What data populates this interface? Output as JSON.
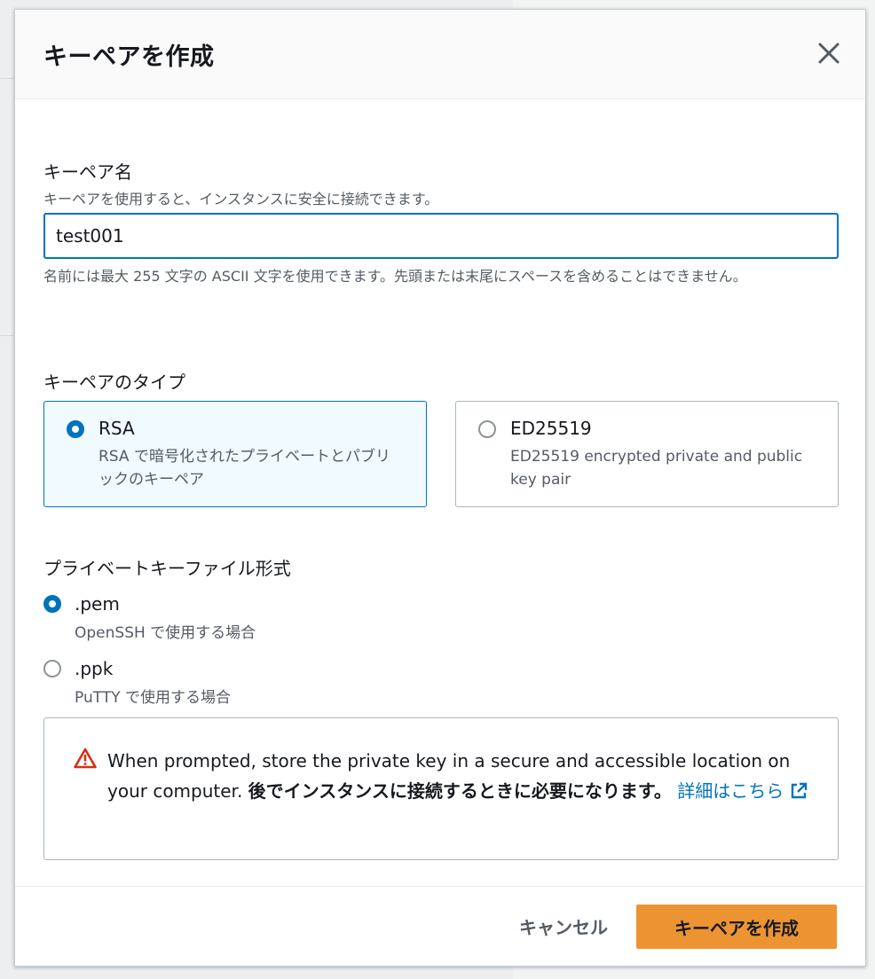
{
  "modal": {
    "title": "キーペアを作成",
    "close_label": "閉じる"
  },
  "key_name": {
    "label": "キーペア名",
    "description": "キーペアを使用すると、インスタンスに安全に接続できます。",
    "value": "test001",
    "constraint": "名前には最大 255 文字の ASCII 文字を使用できます。先頭または末尾にスペースを含めることはできません。"
  },
  "key_type": {
    "label": "キーペアのタイプ",
    "options": [
      {
        "title": "RSA",
        "description": "RSA で暗号化されたプライベートとパブリックのキーペア",
        "selected": true
      },
      {
        "title": "ED25519",
        "description": "ED25519 encrypted private and public key pair",
        "selected": false
      }
    ]
  },
  "file_format": {
    "label": "プライベートキーファイル形式",
    "options": [
      {
        "title": ".pem",
        "description": "OpenSSH で使用する場合",
        "selected": true
      },
      {
        "title": ".ppk",
        "description": "PuTTY で使用する場合",
        "selected": false
      }
    ]
  },
  "alert": {
    "text_en": "When prompted, store the private key in a secure and accessible location on your computer.",
    "text_bold": "後でインスタンスに接続するときに必要になります。",
    "link": "詳細はこちら",
    "icon": "warning-icon",
    "link_icon": "external-link-icon"
  },
  "footer": {
    "cancel_label": "キャンセル",
    "create_label": "キーペアを作成"
  },
  "colors": {
    "accent": "#0073bb",
    "primary_button": "#ec9432",
    "warning": "#d13212",
    "selected_tile_bg": "#f1faff"
  }
}
